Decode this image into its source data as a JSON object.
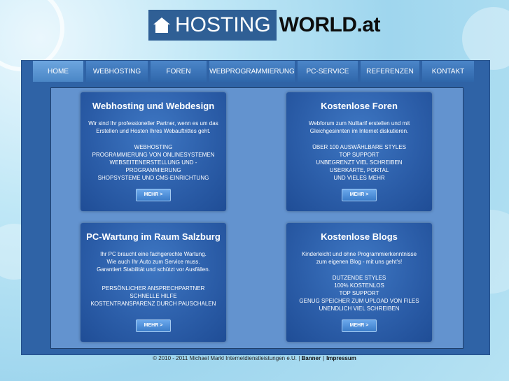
{
  "logo": {
    "left": "HOSTING",
    "right": "WORLD",
    "suffix": ".at"
  },
  "nav": {
    "items": [
      {
        "label": "HOME",
        "active": true
      },
      {
        "label": "WEBHOSTING"
      },
      {
        "label": "FOREN"
      },
      {
        "label": "WEBPROGRAMMIERUNG"
      },
      {
        "label": "PC-SERVICE"
      },
      {
        "label": "REFERENZEN"
      },
      {
        "label": "KONTAKT"
      }
    ]
  },
  "boxes": [
    {
      "title": "Webhosting und Webdesign",
      "desc": [
        "Wir sind Ihr professioneller Partner, wenn es um das",
        "Erstellen und Hosten Ihres Webauftrittes geht."
      ],
      "features": [
        "WEBHOSTING",
        "PROGRAMMIERUNG VON ONLINESYSTEMEN",
        "WEBSEITENERSTELLUNG UND -PROGRAMMIERUNG",
        "SHOPSYSTEME UND CMS-EINRICHTUNG"
      ],
      "button": "MEHR >"
    },
    {
      "title": "Kostenlose Foren",
      "desc": [
        "Webforum zum Nulltarif erstellen und mit",
        "Gleichgesinnten im Internet diskutieren."
      ],
      "features": [
        "ÜBER 100 AUSWÄHLBARE STYLES",
        "TOP SUPPORT",
        "UNBEGRENZT VIEL SCHREIBEN",
        "USERKARTE, PORTAL",
        "UND VIELES MEHR"
      ],
      "button": "MEHR >"
    },
    {
      "title": "PC-Wartung im Raum Salzburg",
      "desc": [
        "Ihr PC braucht eine fachgerechte Wartung.",
        "Wie auch Ihr Auto zum Service muss.",
        "Garantiert Stabilität und schützt vor Ausfällen."
      ],
      "features": [
        "PERSÖNLICHER ANSPRECHPARTNER",
        "SCHNELLE HILFE",
        "KOSTENTRANSPARENZ DURCH PAUSCHALEN"
      ],
      "button": "MEHR >"
    },
    {
      "title": "Kostenlose Blogs",
      "desc": [
        "Kinderleicht und ohne Programmierkenntnisse",
        "zum eigenen Blog - mit uns geht's!"
      ],
      "features": [
        "DUTZENDE STYLES",
        "100% KOSTENLOS",
        "TOP SUPPORT",
        "GENUG SPEICHER ZUM UPLOAD VON FILES",
        "UNENDLICH VIEL SCHREIBEN"
      ],
      "button": "MEHR >"
    }
  ],
  "footer": {
    "copyright": "© 2010 - 2011 Michael Markl Internetdienstleistungen e.U. |",
    "banner": "Banner",
    "separator": "|",
    "impressum": "Impressum"
  },
  "colors": {
    "panel": "#2f63a6",
    "content": "#6393cf",
    "box": "#2b5da8",
    "logo_blue": "#2f5f95"
  }
}
